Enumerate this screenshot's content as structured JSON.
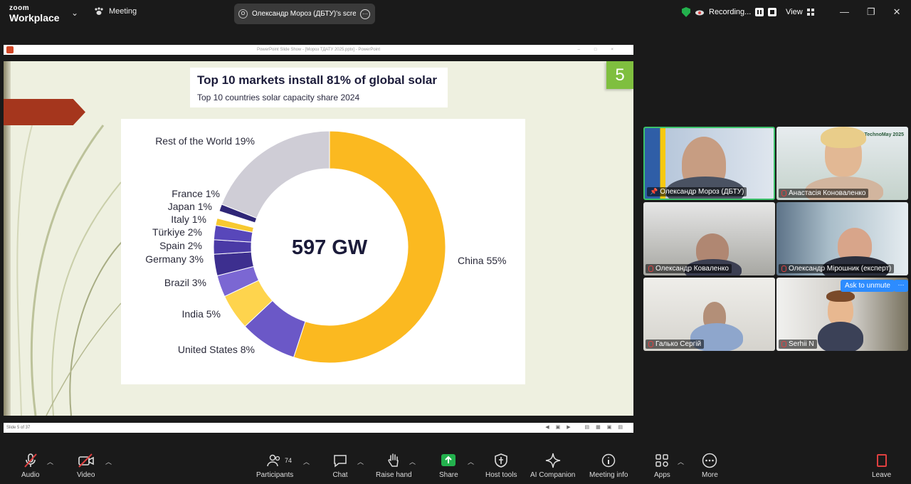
{
  "app": {
    "logo_top": "zoom",
    "logo_bottom": "Workplace",
    "meeting_label": "Meeting",
    "share_initial": "O",
    "share_label": "Олександр Мороз (ДБТУ)'s scree",
    "recording_label": "Recording...",
    "view_label": "View"
  },
  "ppt": {
    "window_title": "PowerPoint Slide Show - [Мороз ТДАТУ 2025.pptx] - PowerPoint",
    "status_text": "Slide 5 of 37"
  },
  "slide": {
    "number": "5",
    "title": "Top 10 markets install 81% of global solar",
    "subtitle": "Top 10 countries solar capacity share 2024",
    "center_label": "597 GW"
  },
  "chart_data": {
    "type": "pie",
    "variant": "donut",
    "total_label": "597 GW",
    "slices": [
      {
        "label": "China 55%",
        "value": 55,
        "color": "#fbb920"
      },
      {
        "label": "United States 8%",
        "value": 8,
        "color": "#6b58c7"
      },
      {
        "label": "India 5%",
        "value": 5,
        "color": "#fed44d"
      },
      {
        "label": "Brazil 3%",
        "value": 3,
        "color": "#7b67d3"
      },
      {
        "label": "Germany 3%",
        "value": 3,
        "color": "#3d2f8f"
      },
      {
        "label": "Spain 2%",
        "value": 2,
        "color": "#4a3aa6"
      },
      {
        "label": "Türkiye 2%",
        "value": 2,
        "color": "#5847ba"
      },
      {
        "label": "Italy 1%",
        "value": 1,
        "color": "#f7c930"
      },
      {
        "label": "Japan 1%",
        "value": 1,
        "color": "#ffffff"
      },
      {
        "label": "France 1%",
        "value": 1,
        "color": "#2f2677"
      },
      {
        "label": "Rest of the World 19%",
        "value": 19,
        "color": "#cfcdd6"
      }
    ]
  },
  "participants": [
    {
      "name": "Олександр Мороз (ДБТУ)",
      "muted": false,
      "pinned": true
    },
    {
      "name": "Анастасія Коноваленко",
      "muted": true,
      "pinned": false
    },
    {
      "name": "Олександр Коваленко",
      "muted": true,
      "pinned": false
    },
    {
      "name": "Олександр Мірошник (експерт)",
      "muted": true,
      "pinned": false
    },
    {
      "name": "Галько Сергій",
      "muted": true,
      "pinned": false
    },
    {
      "name": "Serhii N",
      "muted": true,
      "pinned": false
    }
  ],
  "tile_overlay": {
    "ask_unmute": "Ask to unmute",
    "logo_text": "TechnoMay 2025"
  },
  "toolbar": {
    "audio": "Audio",
    "video": "Video",
    "participants": "Participants",
    "participants_count": "74",
    "chat": "Chat",
    "raise_hand": "Raise hand",
    "share": "Share",
    "host_tools": "Host tools",
    "ai_companion": "AI Companion",
    "meeting_info": "Meeting info",
    "apps": "Apps",
    "more": "More",
    "leave": "Leave"
  },
  "colors": {
    "accent": "#2d8cff",
    "active_speaker": "#3cc26b",
    "share_green": "#23b14d",
    "danger": "#e04040"
  }
}
